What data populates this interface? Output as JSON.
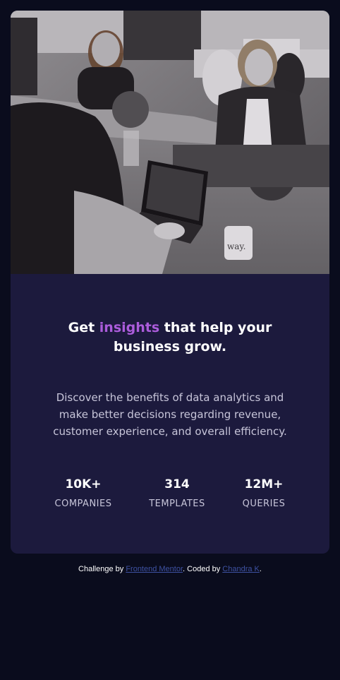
{
  "card": {
    "hero_image": "grayscale-photo-of-women-working-at-laptops",
    "heading": {
      "part1": "Get ",
      "accent": "insights",
      "part2": " that help your business grow."
    },
    "description": "Discover the benefits of data analytics and make better decisions regarding revenue, customer experience, and overall efficiency.",
    "stats": [
      {
        "value": "10K+",
        "label": "COMPANIES"
      },
      {
        "value": "314",
        "label": "TEMPLATES"
      },
      {
        "value": "12M+",
        "label": "QUERIES"
      }
    ]
  },
  "footer": {
    "text_before": "Challenge by ",
    "challenge_link": "Frontend Mentor",
    "text_middle": ". Coded by ",
    "author_link": "Chandra K",
    "text_after": "."
  },
  "colors": {
    "page_bg": "#0a0c1d",
    "card_bg": "#1c1a3d",
    "accent": "#ab5cdb",
    "text_muted": "#c7c5d9",
    "link": "#3e52a3"
  }
}
